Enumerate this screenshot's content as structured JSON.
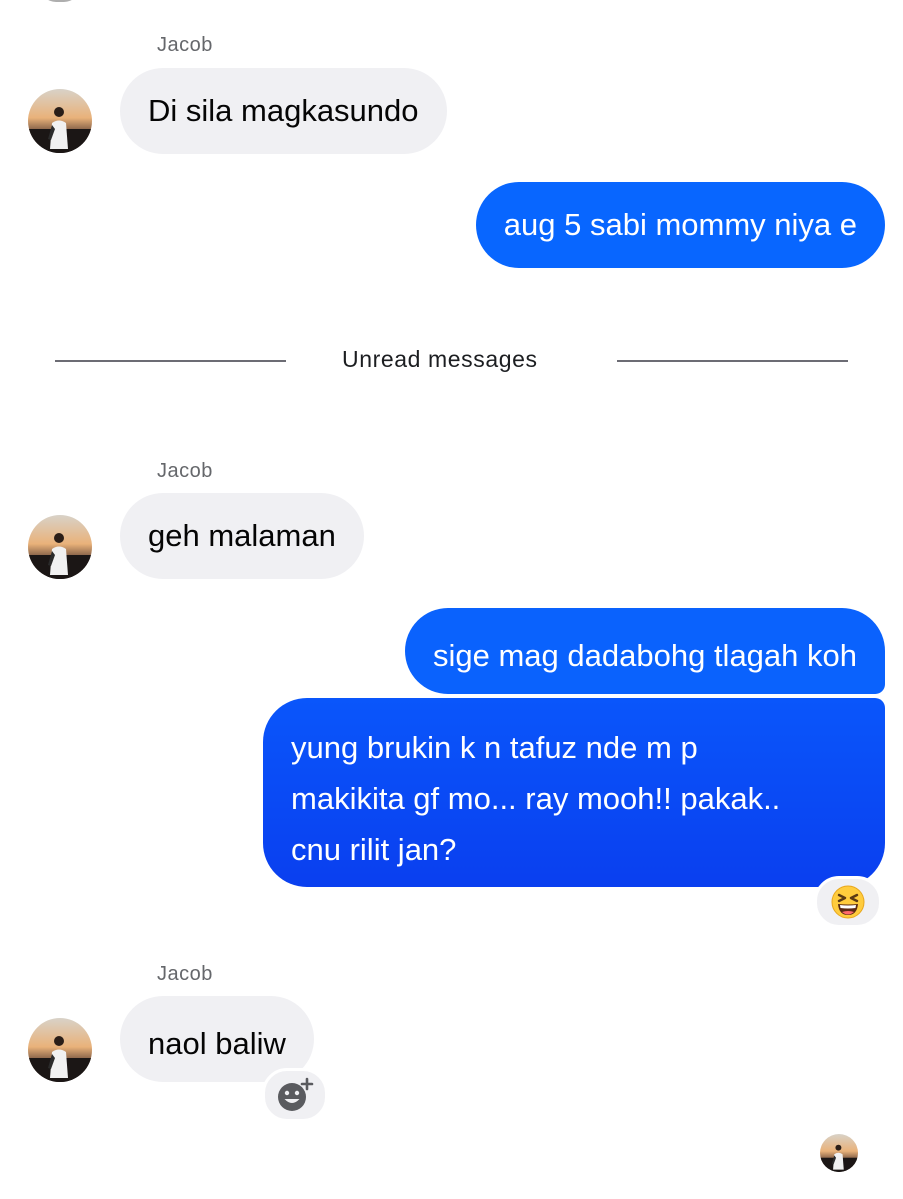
{
  "thread": {
    "divider_label": "Unread messages",
    "messages": [
      {
        "sender": "Jacob",
        "direction": "incoming",
        "text": "Di sila magkasundo"
      },
      {
        "direction": "outgoing",
        "text": "aug 5 sabi mommy niya e"
      },
      {
        "sender": "Jacob",
        "direction": "incoming",
        "text": "geh malaman"
      },
      {
        "direction": "outgoing",
        "text": "sige mag dadabohg tlagah koh"
      },
      {
        "direction": "outgoing",
        "lines": [
          "yung brukin k n tafuz nde m p",
          "makikita gf mo... ray mooh!! pakak..",
          "cnu rilit jan?"
        ],
        "reaction": "grinning-squinting-face"
      },
      {
        "sender": "Jacob",
        "direction": "incoming",
        "text": "naol baliw",
        "reaction_button": "add-reaction-icon"
      }
    ]
  },
  "colors": {
    "outgoing_bubble": "#0866ff",
    "outgoing_gradient_end": "#0a3fef",
    "incoming_bubble": "#f0f0f3",
    "sender_name": "#65676b",
    "divider": "#6c6c74",
    "background": "#ffffff"
  }
}
